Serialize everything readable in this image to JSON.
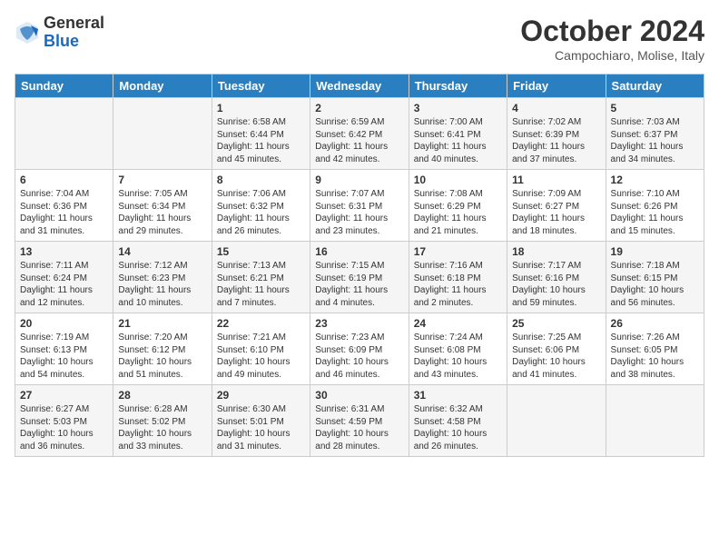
{
  "logo": {
    "line1": "General",
    "line2": "Blue"
  },
  "title": "October 2024",
  "subtitle": "Campochiaro, Molise, Italy",
  "days_of_week": [
    "Sunday",
    "Monday",
    "Tuesday",
    "Wednesday",
    "Thursday",
    "Friday",
    "Saturday"
  ],
  "weeks": [
    [
      {
        "num": "",
        "content": ""
      },
      {
        "num": "",
        "content": ""
      },
      {
        "num": "1",
        "content": "Sunrise: 6:58 AM\nSunset: 6:44 PM\nDaylight: 11 hours and 45 minutes."
      },
      {
        "num": "2",
        "content": "Sunrise: 6:59 AM\nSunset: 6:42 PM\nDaylight: 11 hours and 42 minutes."
      },
      {
        "num": "3",
        "content": "Sunrise: 7:00 AM\nSunset: 6:41 PM\nDaylight: 11 hours and 40 minutes."
      },
      {
        "num": "4",
        "content": "Sunrise: 7:02 AM\nSunset: 6:39 PM\nDaylight: 11 hours and 37 minutes."
      },
      {
        "num": "5",
        "content": "Sunrise: 7:03 AM\nSunset: 6:37 PM\nDaylight: 11 hours and 34 minutes."
      }
    ],
    [
      {
        "num": "6",
        "content": "Sunrise: 7:04 AM\nSunset: 6:36 PM\nDaylight: 11 hours and 31 minutes."
      },
      {
        "num": "7",
        "content": "Sunrise: 7:05 AM\nSunset: 6:34 PM\nDaylight: 11 hours and 29 minutes."
      },
      {
        "num": "8",
        "content": "Sunrise: 7:06 AM\nSunset: 6:32 PM\nDaylight: 11 hours and 26 minutes."
      },
      {
        "num": "9",
        "content": "Sunrise: 7:07 AM\nSunset: 6:31 PM\nDaylight: 11 hours and 23 minutes."
      },
      {
        "num": "10",
        "content": "Sunrise: 7:08 AM\nSunset: 6:29 PM\nDaylight: 11 hours and 21 minutes."
      },
      {
        "num": "11",
        "content": "Sunrise: 7:09 AM\nSunset: 6:27 PM\nDaylight: 11 hours and 18 minutes."
      },
      {
        "num": "12",
        "content": "Sunrise: 7:10 AM\nSunset: 6:26 PM\nDaylight: 11 hours and 15 minutes."
      }
    ],
    [
      {
        "num": "13",
        "content": "Sunrise: 7:11 AM\nSunset: 6:24 PM\nDaylight: 11 hours and 12 minutes."
      },
      {
        "num": "14",
        "content": "Sunrise: 7:12 AM\nSunset: 6:23 PM\nDaylight: 11 hours and 10 minutes."
      },
      {
        "num": "15",
        "content": "Sunrise: 7:13 AM\nSunset: 6:21 PM\nDaylight: 11 hours and 7 minutes."
      },
      {
        "num": "16",
        "content": "Sunrise: 7:15 AM\nSunset: 6:19 PM\nDaylight: 11 hours and 4 minutes."
      },
      {
        "num": "17",
        "content": "Sunrise: 7:16 AM\nSunset: 6:18 PM\nDaylight: 11 hours and 2 minutes."
      },
      {
        "num": "18",
        "content": "Sunrise: 7:17 AM\nSunset: 6:16 PM\nDaylight: 10 hours and 59 minutes."
      },
      {
        "num": "19",
        "content": "Sunrise: 7:18 AM\nSunset: 6:15 PM\nDaylight: 10 hours and 56 minutes."
      }
    ],
    [
      {
        "num": "20",
        "content": "Sunrise: 7:19 AM\nSunset: 6:13 PM\nDaylight: 10 hours and 54 minutes."
      },
      {
        "num": "21",
        "content": "Sunrise: 7:20 AM\nSunset: 6:12 PM\nDaylight: 10 hours and 51 minutes."
      },
      {
        "num": "22",
        "content": "Sunrise: 7:21 AM\nSunset: 6:10 PM\nDaylight: 10 hours and 49 minutes."
      },
      {
        "num": "23",
        "content": "Sunrise: 7:23 AM\nSunset: 6:09 PM\nDaylight: 10 hours and 46 minutes."
      },
      {
        "num": "24",
        "content": "Sunrise: 7:24 AM\nSunset: 6:08 PM\nDaylight: 10 hours and 43 minutes."
      },
      {
        "num": "25",
        "content": "Sunrise: 7:25 AM\nSunset: 6:06 PM\nDaylight: 10 hours and 41 minutes."
      },
      {
        "num": "26",
        "content": "Sunrise: 7:26 AM\nSunset: 6:05 PM\nDaylight: 10 hours and 38 minutes."
      }
    ],
    [
      {
        "num": "27",
        "content": "Sunrise: 6:27 AM\nSunset: 5:03 PM\nDaylight: 10 hours and 36 minutes."
      },
      {
        "num": "28",
        "content": "Sunrise: 6:28 AM\nSunset: 5:02 PM\nDaylight: 10 hours and 33 minutes."
      },
      {
        "num": "29",
        "content": "Sunrise: 6:30 AM\nSunset: 5:01 PM\nDaylight: 10 hours and 31 minutes."
      },
      {
        "num": "30",
        "content": "Sunrise: 6:31 AM\nSunset: 4:59 PM\nDaylight: 10 hours and 28 minutes."
      },
      {
        "num": "31",
        "content": "Sunrise: 6:32 AM\nSunset: 4:58 PM\nDaylight: 10 hours and 26 minutes."
      },
      {
        "num": "",
        "content": ""
      },
      {
        "num": "",
        "content": ""
      }
    ]
  ]
}
